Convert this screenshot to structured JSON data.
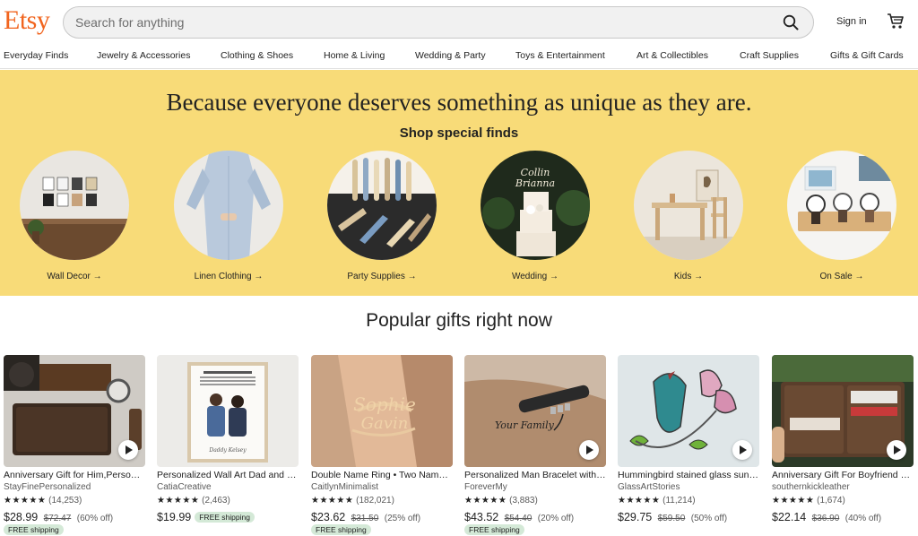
{
  "header": {
    "logo": "Etsy",
    "search_placeholder": "Search for anything",
    "sign_in": "Sign in"
  },
  "nav": [
    "Everyday Finds",
    "Jewelry & Accessories",
    "Clothing & Shoes",
    "Home & Living",
    "Wedding & Party",
    "Toys & Entertainment",
    "Art & Collectibles",
    "Craft Supplies",
    "Gifts & Gift Cards"
  ],
  "banner": {
    "title": "Because everyone deserves something as unique as they are.",
    "subtitle": "Shop special finds",
    "categories": [
      {
        "label": "Wall Decor"
      },
      {
        "label": "Linen Clothing"
      },
      {
        "label": "Party Supplies"
      },
      {
        "label": "Wedding"
      },
      {
        "label": "Kids"
      },
      {
        "label": "On Sale"
      }
    ]
  },
  "popular": {
    "heading": "Popular gifts right now",
    "items": [
      {
        "title": "Anniversary Gift for Him,Personalized Wallet",
        "shop": "StayFinePersonalized",
        "stars": "★★★★★",
        "reviews": "(14,253)",
        "price": "$28.99",
        "original": "$72.47",
        "discount": "(60% off)",
        "shipping": "FREE shipping"
      },
      {
        "title": "Personalized Wall Art Dad and Daughter",
        "shop": "CatiaCreative",
        "stars": "★★★★★",
        "reviews": "(2,463)",
        "price": "$19.99",
        "original": "",
        "discount": "",
        "shipping": "FREE shipping"
      },
      {
        "title": "Double Name Ring • Two Name Ring",
        "shop": "CaitlynMinimalist",
        "stars": "★★★★★",
        "reviews": "(182,021)",
        "price": "$23.62",
        "original": "$31.50",
        "discount": "(25% off)",
        "shipping": "FREE shipping"
      },
      {
        "title": "Personalized Man Bracelet with Beads",
        "shop": "ForeverMy",
        "stars": "★★★★★",
        "reviews": "(3,883)",
        "price": "$43.52",
        "original": "$54.40",
        "discount": "(20% off)",
        "shipping": "FREE shipping"
      },
      {
        "title": "Hummingbird stained glass suncatcher",
        "shop": "GlassArtStories",
        "stars": "★★★★★",
        "reviews": "(11,214)",
        "price": "$29.75",
        "original": "$59.50",
        "discount": "(50% off)",
        "shipping": ""
      },
      {
        "title": "Anniversary Gift For Boyfriend Wallet",
        "shop": "southernkickleather",
        "stars": "★★★★★",
        "reviews": "(1,674)",
        "price": "$22.14",
        "original": "$36.90",
        "discount": "(40% off)",
        "shipping": ""
      }
    ]
  },
  "colors": {
    "brand": "#F1641E",
    "banner_bg": "#F8DB78",
    "shipping_badge": "#D4E9D7"
  }
}
